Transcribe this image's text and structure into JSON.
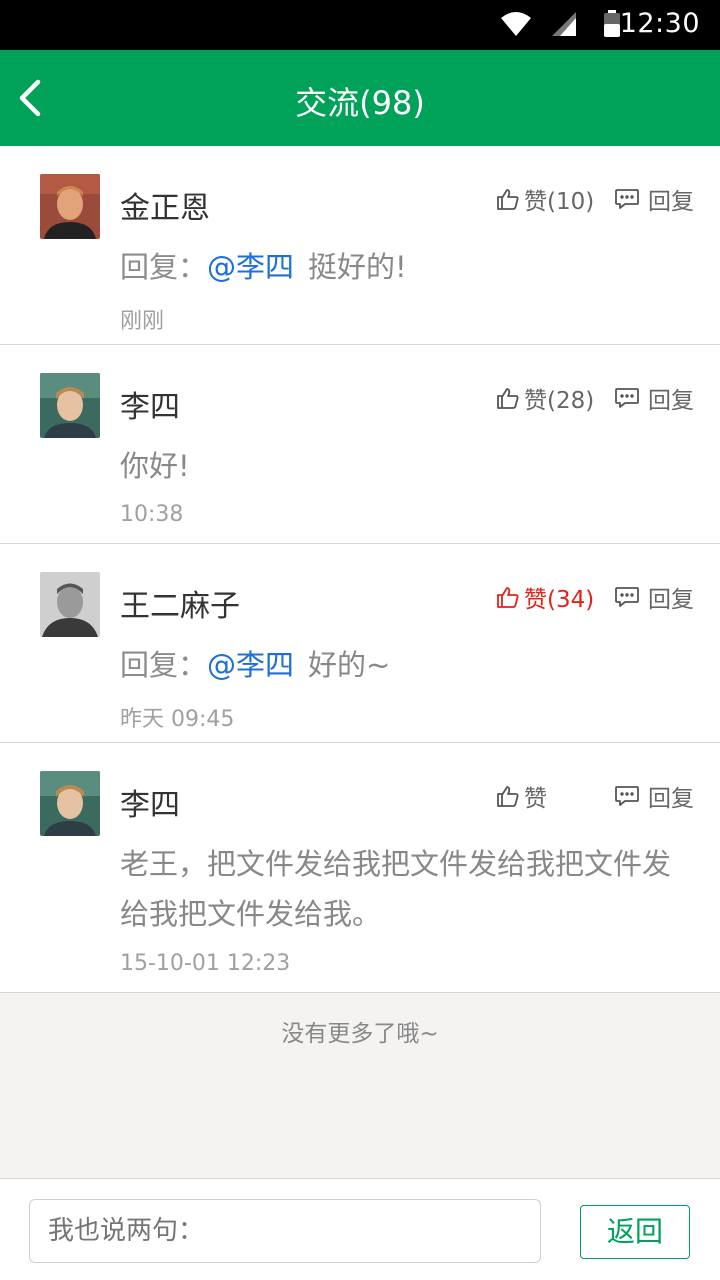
{
  "status_bar": {
    "time": "12:30"
  },
  "header": {
    "title": "交流(98)"
  },
  "comments": [
    {
      "name": "金正恩",
      "likes": "赞(10)",
      "reply": "回复",
      "prefix": "回复：",
      "mention": "@李四",
      "text": "挺好的!",
      "time": "刚刚",
      "liked": false
    },
    {
      "name": "李四",
      "likes": "赞(28)",
      "reply": "回复",
      "text": "你好!",
      "time": "10:38",
      "liked": false
    },
    {
      "name": "王二麻子",
      "likes": "赞(34)",
      "reply": "回复",
      "prefix": "回复：",
      "mention": "@李四",
      "text": "好的~",
      "time": "昨天   09:45",
      "liked": true
    },
    {
      "name": "李四",
      "likes": "赞",
      "reply": "回复",
      "text": "老王，把文件发给我把文件发给我把文件发给我把文件发给我。",
      "time": "15-10-01   12:23",
      "liked": false
    }
  ],
  "footer_note": "没有更多了哦~",
  "input": {
    "placeholder": "我也说两句：",
    "button": "返回"
  },
  "colors": {
    "primary": "#00a25a",
    "mention": "#1e6fd9",
    "liked": "#e0241b"
  }
}
